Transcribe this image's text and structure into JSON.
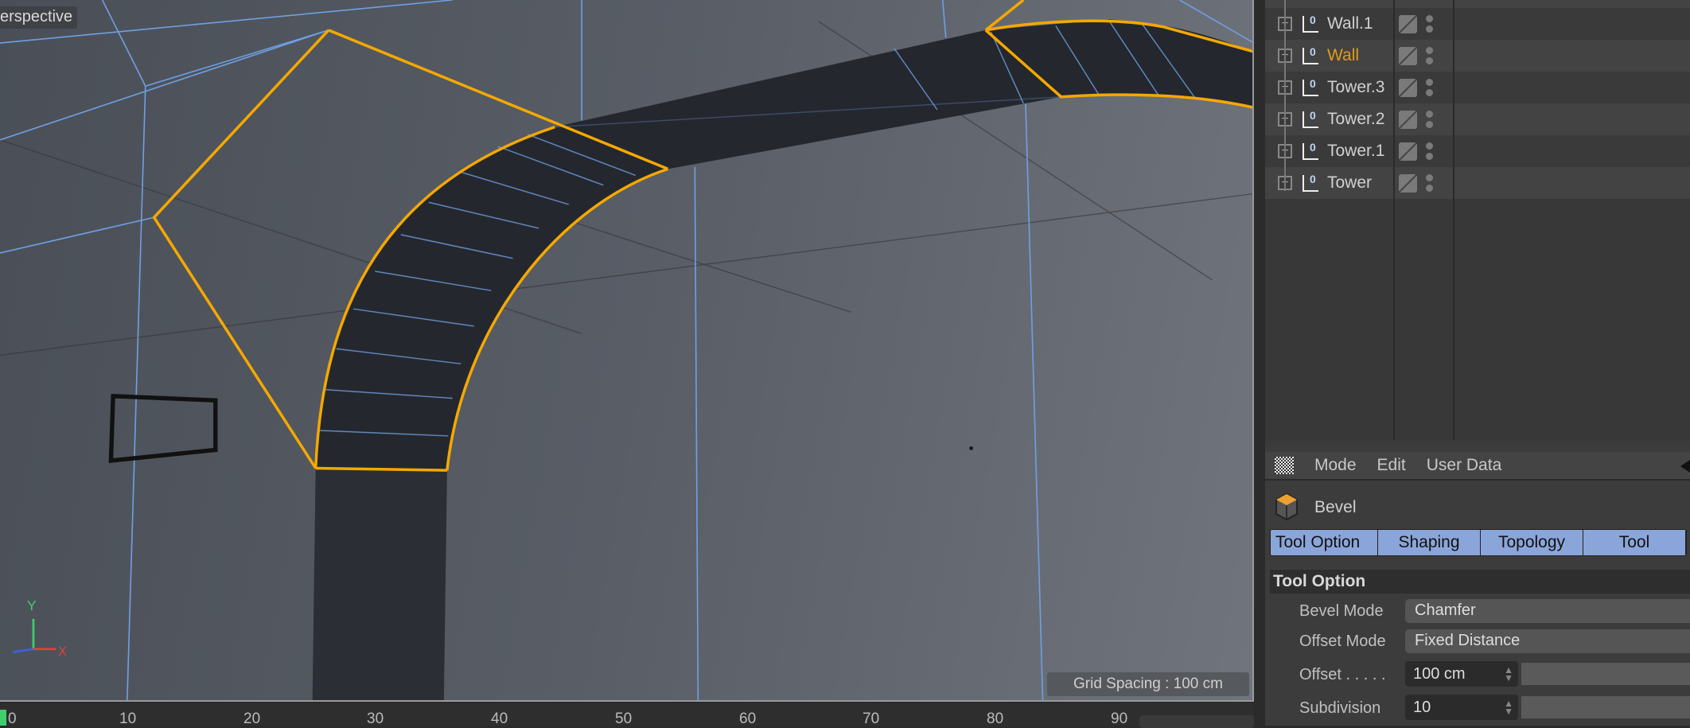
{
  "viewport": {
    "camera_label": "erspective",
    "grid_spacing": "Grid Spacing : 100 cm",
    "axis_labels": {
      "y": "Y",
      "x": "X"
    },
    "colors": {
      "selection": "#f5a800",
      "edge": "#6f9fe0",
      "polygon": "#24272d"
    }
  },
  "timeline": {
    "ticks": [
      "0",
      "10",
      "20",
      "30",
      "40",
      "50",
      "60",
      "70",
      "80",
      "90"
    ],
    "current_frame_color": "#3ecf6a"
  },
  "object_manager": {
    "objects": [
      {
        "name": "Wall.1",
        "icon": "null-object-icon",
        "selected": false
      },
      {
        "name": "Wall",
        "icon": "null-object-icon",
        "selected": true
      },
      {
        "name": "Tower.3",
        "icon": "null-object-icon",
        "selected": false
      },
      {
        "name": "Tower.2",
        "icon": "null-object-icon",
        "selected": false
      },
      {
        "name": "Tower.1",
        "icon": "null-object-icon",
        "selected": false
      },
      {
        "name": "Tower",
        "icon": "null-object-icon",
        "selected": false
      }
    ]
  },
  "attributes": {
    "menu": [
      "Mode",
      "Edit",
      "User Data"
    ],
    "tool_name": "Bevel",
    "tabs": [
      "Tool Option",
      "Shaping",
      "Topology",
      "Tool"
    ],
    "tab_color": "#8aa5d9",
    "section_title": "Tool Option",
    "bevel_mode": {
      "label": "Bevel Mode",
      "value": "Chamfer"
    },
    "offset_mode": {
      "label": "Offset Mode",
      "value": "Fixed Distance"
    },
    "offset": {
      "label": "Offset . . . . .",
      "value": "100 cm"
    },
    "subdivision": {
      "label": "Subdivision",
      "value": "10"
    }
  }
}
